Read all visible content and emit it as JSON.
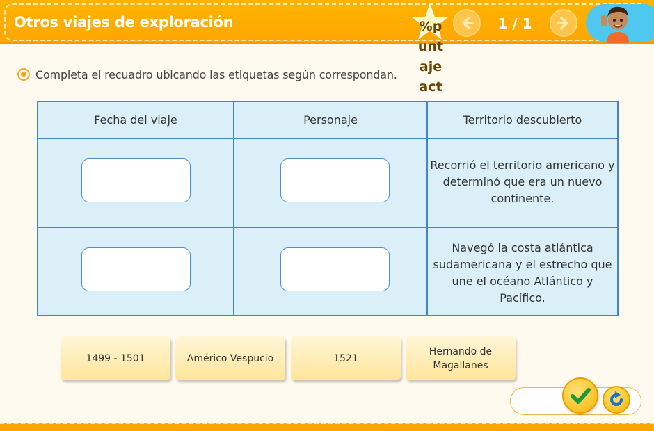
{
  "header": {
    "title": "Otros viajes de exploración",
    "score_text": "%puntajeact",
    "page_indicator": "1 / 1",
    "prev_icon": "arrow-left-icon",
    "next_icon": "arrow-right-icon",
    "avatar_icon": "boy-avatar-icon"
  },
  "instruction": "Completa el recuadro ubicando las etiquetas según correspondan.",
  "table": {
    "headers": [
      "Fecha del viaje",
      "Personaje",
      "Territorio descubierto"
    ],
    "rows": [
      {
        "description": "Recorrió el territorio americano y determinó que era un nuevo continente."
      },
      {
        "description": "Navegó la costa atlántica sudamericana y el estrecho que une el océano Atlántico y Pacífico."
      }
    ]
  },
  "labels": [
    "1499 - 1501",
    "Américo Vespucio",
    "1521",
    "Hernando de Magallanes"
  ],
  "controls": {
    "check_icon": "checkmark-icon",
    "reset_icon": "reset-icon"
  },
  "colors": {
    "header": "#ffa600",
    "grid_border": "#3f86cc",
    "grid_fill": "#daeff8",
    "label_card": "#ffe59c"
  }
}
